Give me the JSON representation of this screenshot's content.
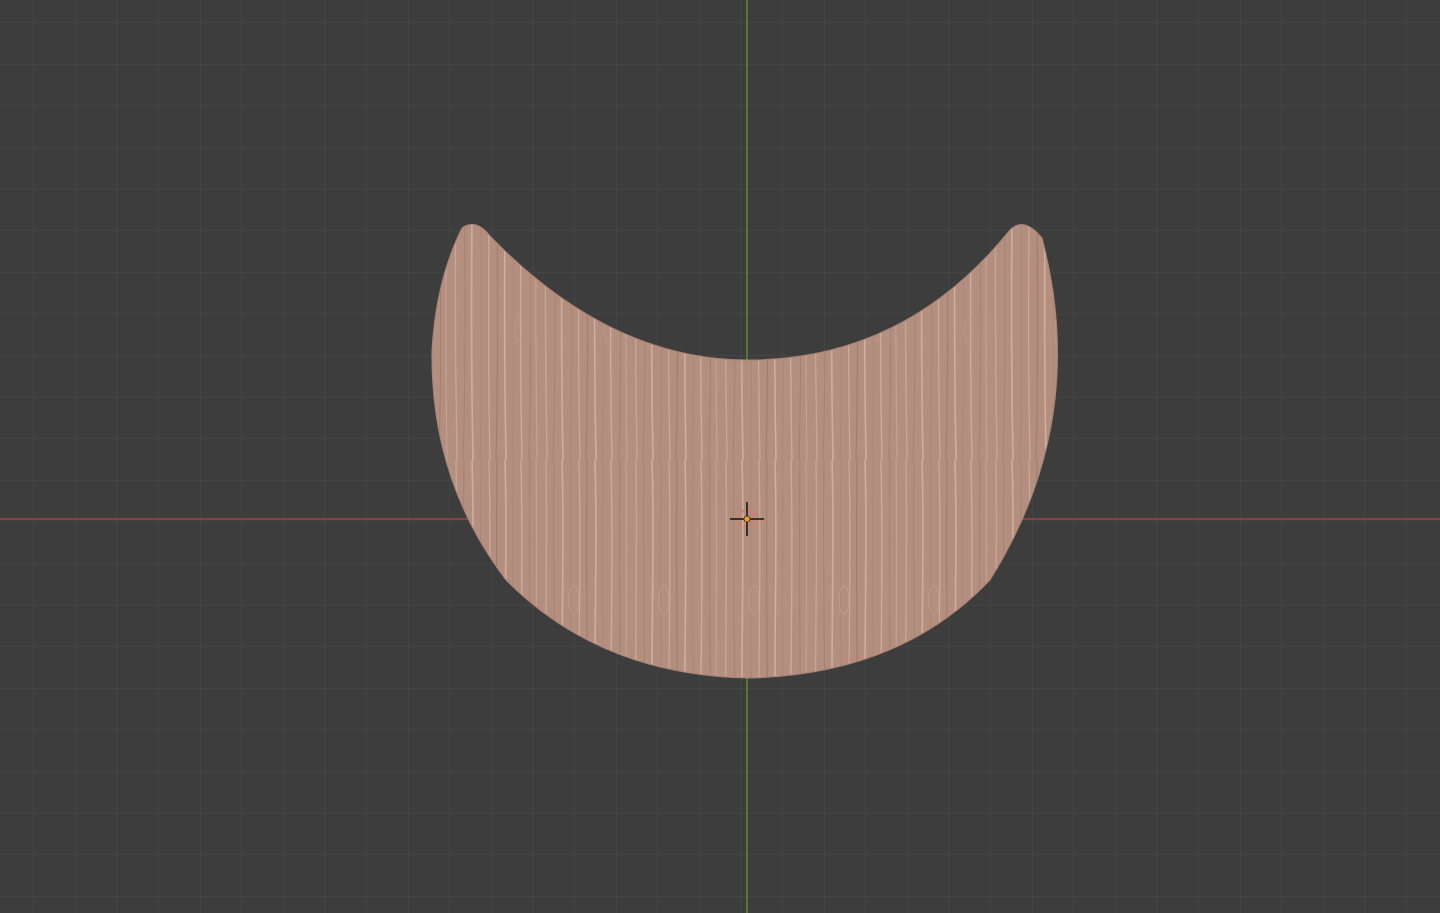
{
  "viewport": {
    "name": "3d-viewport-top-orthographic",
    "background_color": "#3d3d3d",
    "grid_color": "#4a4a4a",
    "x_axis_color": "#b44a4a",
    "y_axis_color": "#6a9a3a"
  },
  "scene": {
    "object": {
      "shape": "crescent",
      "material": "wood",
      "base_color": "#b48e7e",
      "grain_color": "#d4b5a3",
      "dark_grain_color": "#8c6a5e"
    },
    "cursor": {
      "icon": "3d-cursor-icon",
      "ring_color": "#e07a6a",
      "origin_color": "#f0a020"
    }
  }
}
